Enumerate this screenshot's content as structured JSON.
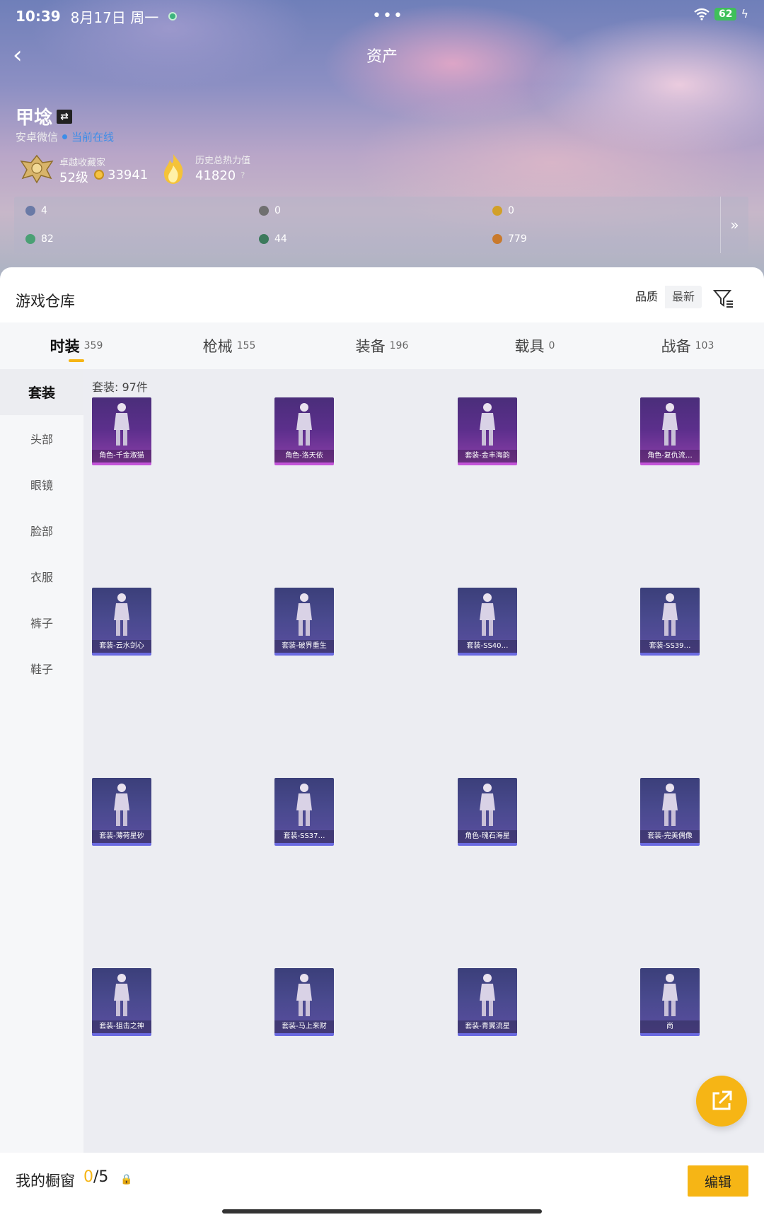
{
  "status": {
    "time": "10:39",
    "date": "8月17日 周一",
    "dots": "•••",
    "battery": "62"
  },
  "nav": {
    "title": "资产",
    "back": "‹"
  },
  "profile": {
    "name": "甲埝",
    "platform": "安卓微信",
    "online": "当前在线",
    "rank_label": "卓越收藏家",
    "level": "52级",
    "coins": "33941",
    "heat_label": "历史总热力值",
    "heat_value": "41820",
    "help": "?"
  },
  "currencies": [
    {
      "value": "4",
      "color": "#6a7aa6"
    },
    {
      "value": "0",
      "color": "#707070"
    },
    {
      "value": "0",
      "color": "#d2a028"
    },
    {
      "value": "82",
      "color": "#4aa074"
    },
    {
      "value": "44",
      "color": "#3c7a5c"
    },
    {
      "value": "779",
      "color": "#c97a2c"
    }
  ],
  "warehouse": {
    "title": "游戏仓库",
    "sort": [
      "品质",
      "最新"
    ],
    "tabs": [
      {
        "label": "时装",
        "count": "359"
      },
      {
        "label": "枪械",
        "count": "155"
      },
      {
        "label": "装备",
        "count": "196"
      },
      {
        "label": "载具",
        "count": "0"
      },
      {
        "label": "战备",
        "count": "103"
      }
    ],
    "sidebar": [
      "套装",
      "头部",
      "眼镜",
      "脸部",
      "衣服",
      "裤子",
      "鞋子"
    ],
    "count_label": "套装: 97件",
    "items": [
      {
        "name": "角色-千金淑猫",
        "tone": "purple"
      },
      {
        "name": "角色-洛天依",
        "tone": "purple"
      },
      {
        "name": "套装-金丰海韵",
        "tone": "purple"
      },
      {
        "name": "角色-复仇流…",
        "tone": "purple"
      },
      {
        "name": "套装-云水剑心",
        "tone": "blue"
      },
      {
        "name": "套装-破界重生",
        "tone": "blue"
      },
      {
        "name": "套装-SS40…",
        "tone": "blue"
      },
      {
        "name": "套装-SS39…",
        "tone": "blue"
      },
      {
        "name": "套装-薄荷星砂",
        "tone": "blue"
      },
      {
        "name": "套装-SS37…",
        "tone": "blue"
      },
      {
        "name": "角色-瑰石海星",
        "tone": "blue"
      },
      {
        "name": "套装-完美偶像",
        "tone": "blue"
      },
      {
        "name": "套装-狙击之神",
        "tone": "blue"
      },
      {
        "name": "套装-马上来财",
        "tone": "blue"
      },
      {
        "name": "套装-青翼流星",
        "tone": "blue"
      },
      {
        "name": "尚",
        "tone": "blue"
      }
    ]
  },
  "showcase": {
    "label": "我的橱窗",
    "used": "0",
    "total": "/5",
    "edit": "编辑"
  }
}
